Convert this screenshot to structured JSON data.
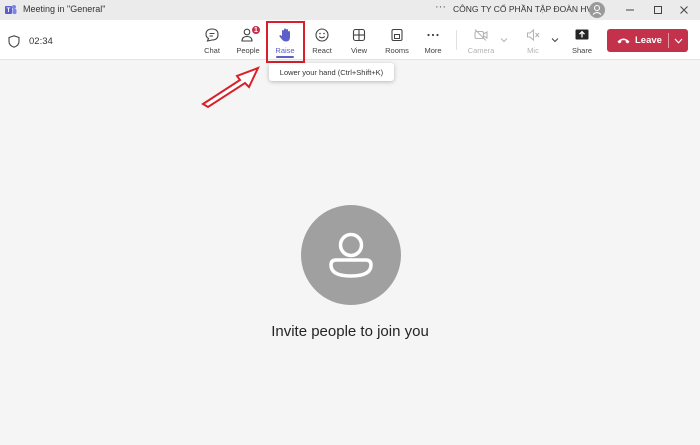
{
  "window": {
    "title": "Meeting in \"General\"",
    "more_label": "···",
    "org_name": "CÔNG TY CỔ PHẦN TẬP ĐOÀN HVN"
  },
  "meeting": {
    "timer": "02:34"
  },
  "toolbar": {
    "chat_label": "Chat",
    "people_label": "People",
    "people_badge": "1",
    "raise_label": "Raise",
    "react_label": "React",
    "view_label": "View",
    "rooms_label": "Rooms",
    "more_label": "More",
    "camera_label": "Camera",
    "mic_label": "Mic",
    "share_label": "Share",
    "leave_label": "Leave"
  },
  "tooltip": {
    "text": "Lower your hand (Ctrl+Shift+K)"
  },
  "stage": {
    "message": "Invite people to join you"
  },
  "colors": {
    "accent": "#5b5fc7",
    "leave": "#c4314b",
    "highlight": "#d9202a",
    "badge": "#c4314b"
  },
  "icons": [
    "teams-icon",
    "shield-icon",
    "chat-icon",
    "people-icon",
    "hand-icon",
    "smiley-icon",
    "grid-icon",
    "rooms-icon",
    "more-icon",
    "camera-off-icon",
    "mic-off-icon",
    "share-icon",
    "phone-icon",
    "chevron-down-icon",
    "minimize-icon",
    "maximize-icon",
    "close-icon",
    "avatar-icon",
    "arrow-icon"
  ]
}
